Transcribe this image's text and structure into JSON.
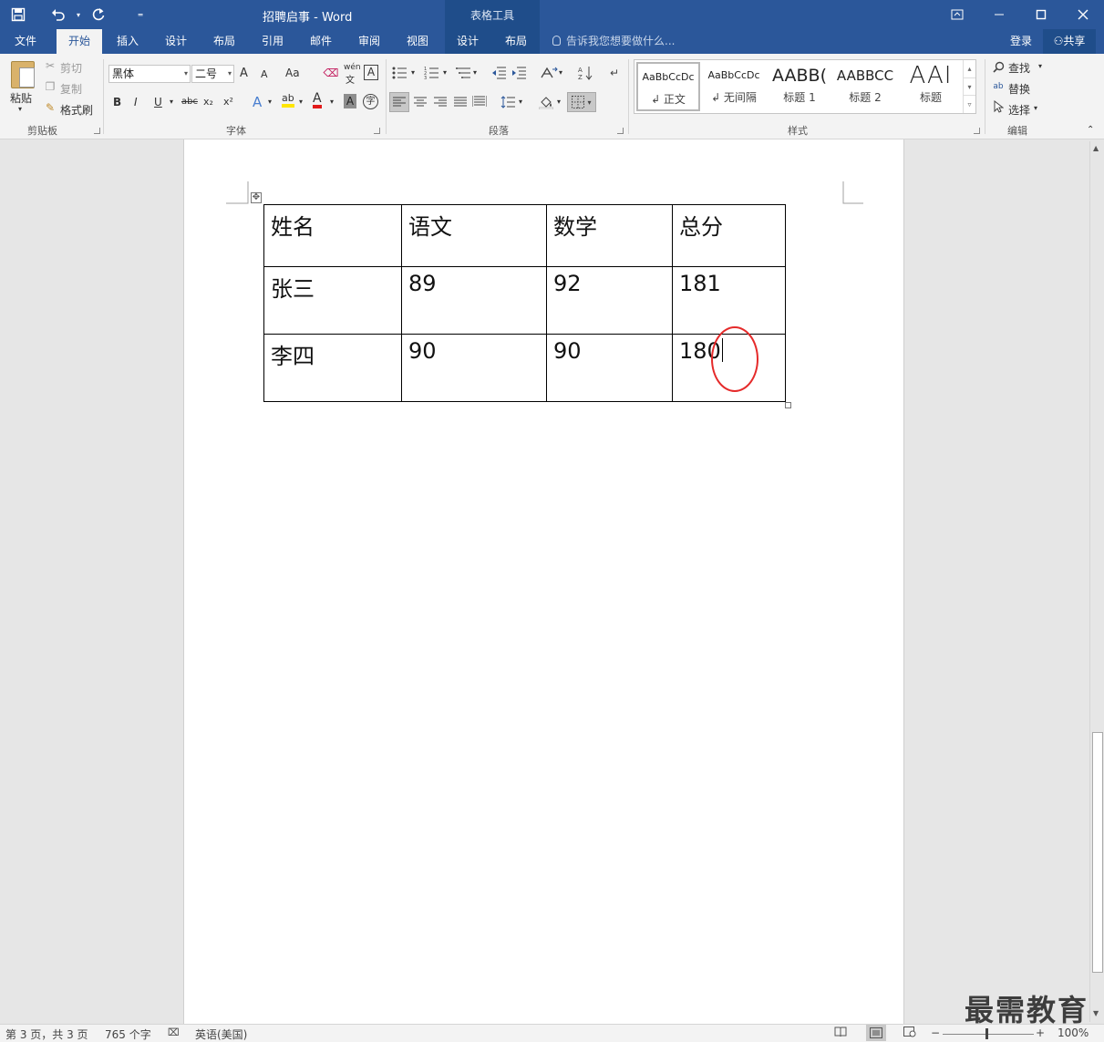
{
  "window": {
    "title": "招聘启事 - Word",
    "context_tools_label": "表格工具"
  },
  "qat": {
    "save_icon": "save-icon",
    "undo_icon": "undo-icon",
    "redo_icon": "redo-icon"
  },
  "tabs": [
    {
      "label": "文件"
    },
    {
      "label": "开始"
    },
    {
      "label": "插入"
    },
    {
      "label": "设计"
    },
    {
      "label": "布局"
    },
    {
      "label": "引用"
    },
    {
      "label": "邮件"
    },
    {
      "label": "审阅"
    },
    {
      "label": "视图"
    },
    {
      "label": "设计"
    },
    {
      "label": "布局"
    }
  ],
  "tellme_placeholder": "告诉我您想要做什么...",
  "account": {
    "signin": "登录",
    "share": "共享"
  },
  "ribbon": {
    "clipboard": {
      "label": "剪贴板",
      "paste": "粘贴",
      "cut": "剪切",
      "copy": "复制",
      "format_painter": "格式刷"
    },
    "font": {
      "label": "字体",
      "font_name": "黑体",
      "font_size": "二号",
      "bold": "B",
      "italic": "I",
      "underline": "U",
      "strike": "abc",
      "sub": "x₂",
      "sup": "x²",
      "change_case": "Aa",
      "phonetic": "wén",
      "phonetic_sub": "文",
      "charborder": "A",
      "texteffect": "A",
      "highlight": "ab",
      "fontcolor": "A",
      "shading": "A",
      "enclose": "字",
      "grow": "A",
      "shrink": "A"
    },
    "paragraph": {
      "label": "段落"
    },
    "styles": {
      "label": "样式",
      "items": [
        {
          "sample": "AaBbCcDc",
          "name": "↲ 正文"
        },
        {
          "sample": "AaBbCcDc",
          "name": "↲ 无间隔"
        },
        {
          "sample": "AABB(",
          "name": "标题 1"
        },
        {
          "sample": "AABBCC",
          "name": "标题 2"
        },
        {
          "sample": "AAI",
          "name": "标题"
        }
      ]
    },
    "editing": {
      "label": "编辑",
      "find": "查找",
      "replace": "替换",
      "select": "选择"
    }
  },
  "table": {
    "rows": [
      [
        "姓名",
        "语文",
        "数学",
        "总分"
      ],
      [
        "张三",
        "89",
        "92",
        "181"
      ],
      [
        "李四",
        "90",
        "90",
        "180"
      ]
    ]
  },
  "status": {
    "page": "第 3 页，共 3 页",
    "words": "765 个字",
    "language": "英语(美国)",
    "zoom": "100%"
  },
  "watermark": "最需教育",
  "colors": {
    "brand": "#2b579a",
    "annotation": "#e52a2a"
  }
}
